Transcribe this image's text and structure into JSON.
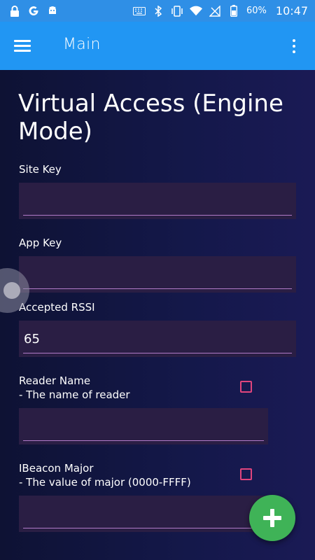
{
  "status_bar": {
    "battery_percent": "60%",
    "time": "10:47",
    "icons_left": [
      "lock-icon",
      "google-icon",
      "android-icon"
    ],
    "icons_right": [
      "keyboard-icon",
      "bluetooth-icon",
      "vibrate-icon",
      "wifi-icon",
      "no-signal-icon",
      "battery-icon"
    ]
  },
  "app_bar": {
    "title": "Main"
  },
  "page": {
    "title": "Virtual Access (Engine Mode)"
  },
  "fields": {
    "site_key": {
      "label": "Site Key",
      "value": ""
    },
    "app_key": {
      "label": "App Key",
      "value": ""
    },
    "accepted_rssi": {
      "label": "Accepted RSSI",
      "value": "65"
    },
    "reader_name": {
      "label": "Reader Name",
      "description": "- The name of reader",
      "value": "",
      "checked": false
    },
    "ibeacon_major": {
      "label": "IBeacon Major",
      "description": "- The value of major (0000-FFFF)",
      "value": "",
      "checked": false
    }
  },
  "colors": {
    "status_bar": "#2f8fe6",
    "app_bar": "#2196f3",
    "field_bg": "#2a1e44",
    "field_underline": "#b07ac8",
    "checkbox": "#e0457d",
    "fab": "#3fb357"
  },
  "fab": {
    "icon": "plus-icon"
  }
}
